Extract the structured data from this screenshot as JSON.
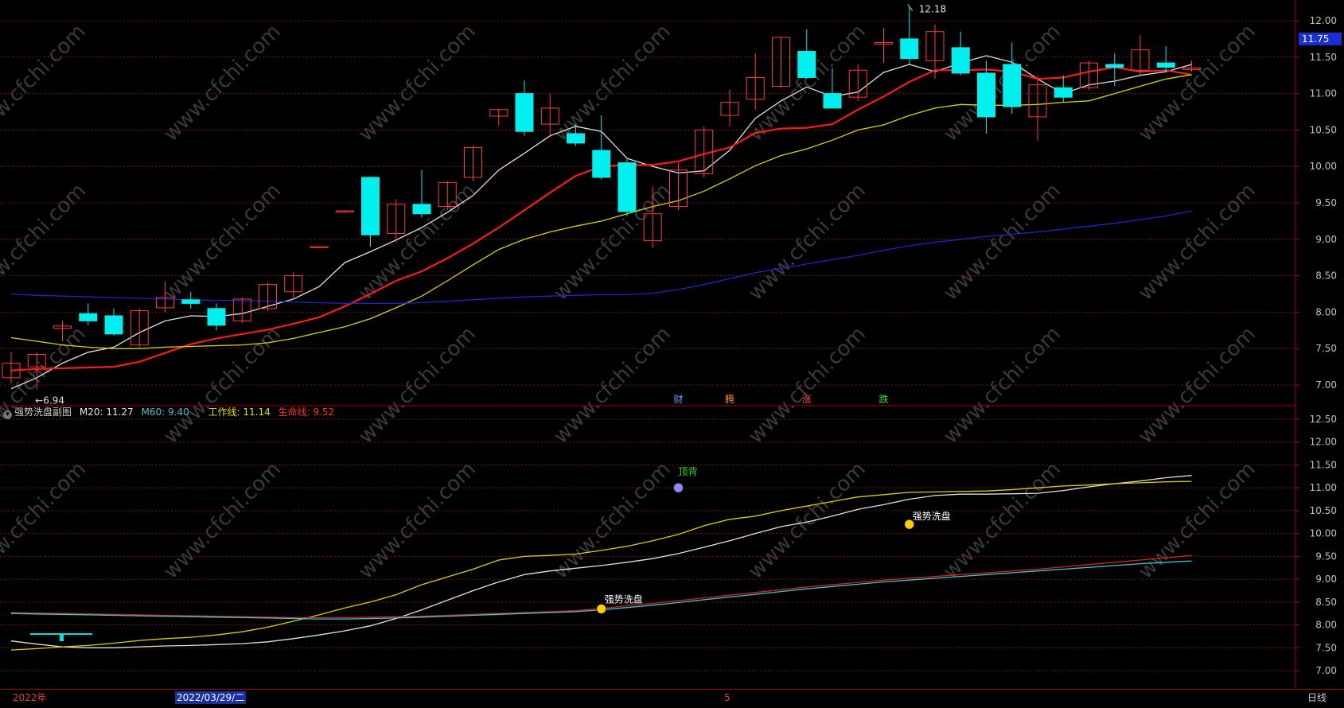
{
  "chart_data": [
    {
      "type": "candlestick",
      "panel": "main",
      "ylim": [
        6.85,
        12.2
      ],
      "y_ticks": [
        "12.00",
        "11.50",
        "11.00",
        "10.50",
        "10.00",
        "9.50",
        "9.00",
        "8.50",
        "8.00",
        "7.50",
        "7.00"
      ],
      "y_tick_values": [
        12.0,
        11.5,
        11.0,
        10.5,
        10.0,
        9.5,
        9.0,
        8.5,
        8.0,
        7.5,
        7.0
      ],
      "current_price": "11.75",
      "high_marker": "12.18",
      "low_marker": "6.94",
      "candles": [
        {
          "o": 7.1,
          "h": 7.45,
          "l": 7.02,
          "c": 7.3
        },
        {
          "o": 7.25,
          "h": 7.45,
          "l": 6.94,
          "c": 7.42
        },
        {
          "o": 7.78,
          "h": 7.88,
          "l": 7.6,
          "c": 7.81
        },
        {
          "o": 7.98,
          "h": 8.12,
          "l": 7.82,
          "c": 7.88
        },
        {
          "o": 7.95,
          "h": 8.05,
          "l": 7.68,
          "c": 7.7
        },
        {
          "o": 7.55,
          "h": 8.05,
          "l": 7.52,
          "c": 8.02
        },
        {
          "o": 8.06,
          "h": 8.42,
          "l": 8.0,
          "c": 8.2
        },
        {
          "o": 8.17,
          "h": 8.28,
          "l": 8.05,
          "c": 8.12
        },
        {
          "o": 8.05,
          "h": 8.12,
          "l": 7.75,
          "c": 7.82
        },
        {
          "o": 7.88,
          "h": 8.2,
          "l": 7.85,
          "c": 8.18
        },
        {
          "o": 8.05,
          "h": 8.4,
          "l": 8.02,
          "c": 8.38
        },
        {
          "o": 8.28,
          "h": 8.55,
          "l": 8.2,
          "c": 8.5
        },
        {
          "o": 8.89,
          "h": 8.9,
          "l": 8.89,
          "c": 8.9
        },
        {
          "o": 9.38,
          "h": 9.4,
          "l": 9.37,
          "c": 9.39
        },
        {
          "o": 9.85,
          "h": 9.86,
          "l": 8.9,
          "c": 9.06
        },
        {
          "o": 9.08,
          "h": 9.55,
          "l": 8.95,
          "c": 9.48
        },
        {
          "o": 9.48,
          "h": 9.95,
          "l": 9.3,
          "c": 9.35
        },
        {
          "o": 9.45,
          "h": 9.8,
          "l": 9.4,
          "c": 9.78
        },
        {
          "o": 9.85,
          "h": 10.28,
          "l": 9.8,
          "c": 10.26
        },
        {
          "o": 10.69,
          "h": 10.79,
          "l": 10.56,
          "c": 10.78
        },
        {
          "o": 11.0,
          "h": 11.18,
          "l": 10.42,
          "c": 10.48
        },
        {
          "o": 10.58,
          "h": 11.0,
          "l": 10.4,
          "c": 10.8
        },
        {
          "o": 10.45,
          "h": 10.58,
          "l": 10.28,
          "c": 10.32
        },
        {
          "o": 10.22,
          "h": 10.7,
          "l": 9.82,
          "c": 9.85
        },
        {
          "o": 10.05,
          "h": 10.1,
          "l": 9.32,
          "c": 9.38
        },
        {
          "o": 8.98,
          "h": 9.72,
          "l": 8.88,
          "c": 9.35
        },
        {
          "o": 9.45,
          "h": 10.05,
          "l": 9.4,
          "c": 9.95
        },
        {
          "o": 9.9,
          "h": 10.55,
          "l": 9.85,
          "c": 10.5
        },
        {
          "o": 10.7,
          "h": 11.05,
          "l": 10.55,
          "c": 10.88
        },
        {
          "o": 10.92,
          "h": 11.55,
          "l": 10.78,
          "c": 11.22
        },
        {
          "o": 11.1,
          "h": 11.78,
          "l": 11.08,
          "c": 11.77
        },
        {
          "o": 11.58,
          "h": 11.88,
          "l": 11.2,
          "c": 11.22
        },
        {
          "o": 11.0,
          "h": 11.35,
          "l": 10.95,
          "c": 10.8
        },
        {
          "o": 10.95,
          "h": 11.4,
          "l": 10.9,
          "c": 11.32
        },
        {
          "o": 11.68,
          "h": 11.9,
          "l": 11.42,
          "c": 11.7
        },
        {
          "o": 11.75,
          "h": 12.18,
          "l": 11.4,
          "c": 11.48
        },
        {
          "o": 11.45,
          "h": 11.95,
          "l": 11.2,
          "c": 11.85
        },
        {
          "o": 11.63,
          "h": 11.85,
          "l": 11.25,
          "c": 11.28
        },
        {
          "o": 11.28,
          "h": 11.45,
          "l": 10.45,
          "c": 10.68
        },
        {
          "o": 11.4,
          "h": 11.7,
          "l": 10.72,
          "c": 10.82
        },
        {
          "o": 10.68,
          "h": 11.25,
          "l": 10.35,
          "c": 11.12
        },
        {
          "o": 11.08,
          "h": 11.25,
          "l": 10.88,
          "c": 10.95
        },
        {
          "o": 11.08,
          "h": 11.45,
          "l": 11.05,
          "c": 11.42
        },
        {
          "o": 11.4,
          "h": 11.55,
          "l": 11.1,
          "c": 11.36
        },
        {
          "o": 11.32,
          "h": 11.8,
          "l": 11.25,
          "c": 11.6
        },
        {
          "o": 11.42,
          "h": 11.65,
          "l": 11.3,
          "c": 11.36
        },
        {
          "o": 11.33,
          "h": 11.45,
          "l": 11.3,
          "c": 11.35
        }
      ],
      "ma_lines": [
        {
          "color": "#e0e0e0",
          "values": [
            6.95,
            7.1,
            7.3,
            7.45,
            7.52,
            7.72,
            7.88,
            7.95,
            7.94,
            7.98,
            8.08,
            8.18,
            8.35,
            8.68,
            8.83,
            8.99,
            9.16,
            9.37,
            9.6,
            9.95,
            10.18,
            10.42,
            10.55,
            10.48,
            10.11,
            10.0,
            9.91,
            9.94,
            10.22,
            10.66,
            10.9,
            11.09,
            10.96,
            11.02,
            11.29,
            11.4,
            11.3,
            11.42,
            11.52,
            11.43,
            11.2,
            11.0,
            11.12,
            11.17,
            11.25,
            11.3,
            11.4
          ]
        },
        {
          "color": "#ff1a1a",
          "values": [
            7.2,
            7.22,
            7.23,
            7.24,
            7.25,
            7.32,
            7.44,
            7.56,
            7.64,
            7.7,
            7.76,
            7.84,
            7.93,
            8.08,
            8.25,
            8.43,
            8.56,
            8.74,
            8.94,
            9.16,
            9.4,
            9.64,
            9.87,
            10.0,
            10.02,
            10.02,
            10.07,
            10.17,
            10.26,
            10.46,
            10.52,
            10.53,
            10.58,
            10.78,
            10.96,
            11.16,
            11.32,
            11.32,
            11.33,
            11.3,
            11.2,
            11.22,
            11.3,
            11.36,
            11.3,
            11.32,
            11.26
          ]
        },
        {
          "color": "#d6d600",
          "values": [
            7.65,
            7.6,
            7.55,
            7.52,
            7.5,
            7.5,
            7.52,
            7.53,
            7.54,
            7.55,
            7.58,
            7.64,
            7.72,
            7.8,
            7.91,
            8.06,
            8.22,
            8.43,
            8.65,
            8.86,
            9.0,
            9.1,
            9.18,
            9.25,
            9.35,
            9.45,
            9.53,
            9.66,
            9.83,
            10.01,
            10.15,
            10.24,
            10.36,
            10.5,
            10.57,
            10.7,
            10.8,
            10.85,
            10.84,
            10.84,
            10.85,
            10.88,
            10.9,
            11.0,
            11.1,
            11.2,
            11.26
          ]
        },
        {
          "color": "#1f26c9",
          "values": [
            8.25,
            8.23,
            8.22,
            8.21,
            8.2,
            8.19,
            8.18,
            8.17,
            8.16,
            8.16,
            8.15,
            8.14,
            8.13,
            8.12,
            8.12,
            8.12,
            8.13,
            8.15,
            8.17,
            8.19,
            8.21,
            8.22,
            8.23,
            8.24,
            8.24,
            8.26,
            8.31,
            8.38,
            8.46,
            8.54,
            8.6,
            8.66,
            8.72,
            8.78,
            8.85,
            8.91,
            8.96,
            9.0,
            9.04,
            9.07,
            9.1,
            9.14,
            9.18,
            9.22,
            9.27,
            9.32,
            9.39
          ]
        }
      ],
      "event_markers": [
        "财",
        "腾",
        "涨",
        "跌"
      ]
    },
    {
      "type": "line",
      "panel": "indicator",
      "title": "强势洗盘副图",
      "ylim": [
        6.85,
        12.65
      ],
      "y_ticks": [
        "12.50",
        "12.00",
        "11.50",
        "11.00",
        "10.50",
        "10.00",
        "9.50",
        "9.00",
        "8.50",
        "8.00",
        "7.50",
        "7.00"
      ],
      "y_tick_values": [
        12.5,
        12.0,
        11.5,
        11.0,
        10.5,
        10.0,
        9.5,
        9.0,
        8.5,
        8.0,
        7.5,
        7.0
      ],
      "legend": [
        {
          "label": "M20: 11.27",
          "color": "#e6e6e6"
        },
        {
          "label": "M60: 9.40",
          "color": "#3cc8d2"
        },
        {
          "label": "工作线: 11.14",
          "color": "#e0e000"
        },
        {
          "label": "生命线: 9.52",
          "color": "#ff3030"
        }
      ],
      "series": [
        {
          "name": "M20",
          "color": "#e0e0e0",
          "values": [
            7.65,
            7.58,
            7.52,
            7.5,
            7.5,
            7.52,
            7.54,
            7.55,
            7.57,
            7.59,
            7.63,
            7.7,
            7.78,
            7.87,
            7.98,
            8.14,
            8.33,
            8.54,
            8.75,
            8.94,
            9.1,
            9.18,
            9.24,
            9.3,
            9.37,
            9.45,
            9.56,
            9.7,
            9.84,
            10.0,
            10.15,
            10.25,
            10.38,
            10.53,
            10.63,
            10.75,
            10.83,
            10.86,
            10.86,
            10.87,
            10.88,
            10.94,
            11.02,
            11.09,
            11.15,
            11.22,
            11.27
          ]
        },
        {
          "name": "工作线",
          "color": "#d4d400",
          "values": [
            7.45,
            7.48,
            7.52,
            7.55,
            7.6,
            7.66,
            7.7,
            7.73,
            7.78,
            7.85,
            7.95,
            8.08,
            8.22,
            8.37,
            8.5,
            8.66,
            8.88,
            9.05,
            9.22,
            9.42,
            9.5,
            9.52,
            9.55,
            9.63,
            9.72,
            9.84,
            9.98,
            10.17,
            10.31,
            10.38,
            10.5,
            10.6,
            10.7,
            10.8,
            10.85,
            10.9,
            10.91,
            10.92,
            10.93,
            10.96,
            11.0,
            11.04,
            11.06,
            11.09,
            11.11,
            11.13,
            11.14
          ]
        },
        {
          "name": "生命线",
          "color": "#e02020",
          "values": [
            8.27,
            8.26,
            8.25,
            8.24,
            8.23,
            8.22,
            8.21,
            8.2,
            8.19,
            8.18,
            8.17,
            8.16,
            8.16,
            8.16,
            8.17,
            8.18,
            8.19,
            8.21,
            8.23,
            8.25,
            8.27,
            8.29,
            8.31,
            8.36,
            8.42,
            8.47,
            8.53,
            8.59,
            8.65,
            8.71,
            8.77,
            8.83,
            8.88,
            8.93,
            8.98,
            9.02,
            9.06,
            9.1,
            9.14,
            9.18,
            9.22,
            9.27,
            9.32,
            9.37,
            9.42,
            9.47,
            9.52
          ]
        },
        {
          "name": "M60",
          "color": "#3cc8d2",
          "values": [
            8.25,
            8.24,
            8.23,
            8.22,
            8.21,
            8.2,
            8.19,
            8.18,
            8.17,
            8.16,
            8.15,
            8.14,
            8.13,
            8.13,
            8.14,
            8.15,
            8.17,
            8.19,
            8.21,
            8.23,
            8.25,
            8.27,
            8.29,
            8.33,
            8.38,
            8.43,
            8.49,
            8.55,
            8.61,
            8.67,
            8.73,
            8.79,
            8.84,
            8.89,
            8.94,
            8.98,
            9.02,
            9.06,
            9.1,
            9.14,
            9.18,
            9.22,
            9.26,
            9.3,
            9.34,
            9.37,
            9.4
          ]
        }
      ],
      "annotations": [
        {
          "text": "顶背",
          "color": "#22dd22"
        },
        {
          "text": "强势洗盘",
          "color": "#ffffff"
        },
        {
          "text": "强势洗盘",
          "color": "#ffffff"
        }
      ]
    }
  ],
  "watermark": "www.cfchi.com",
  "bottom_bar": {
    "year": "2022年",
    "date": "2022/03/29/二",
    "mid": "5",
    "period": "日线"
  }
}
